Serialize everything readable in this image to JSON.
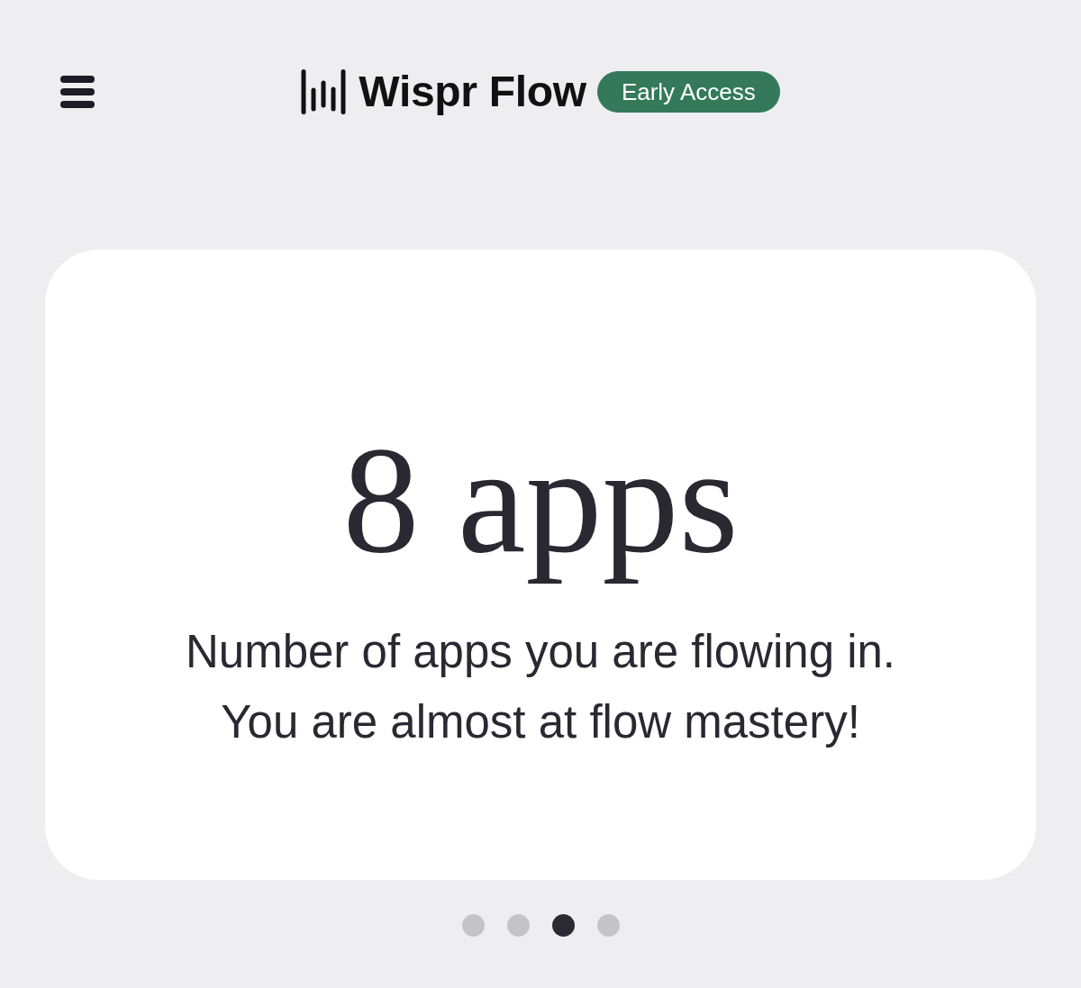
{
  "header": {
    "app_name": "Wispr Flow",
    "badge": "Early Access"
  },
  "card": {
    "headline": "8 apps",
    "lines": [
      "Number of apps you are flowing in.",
      "You are almost at flow mastery!"
    ]
  },
  "pager": [
    {
      "selected": false
    },
    {
      "selected": false
    },
    {
      "selected": true
    },
    {
      "selected": false
    }
  ]
}
